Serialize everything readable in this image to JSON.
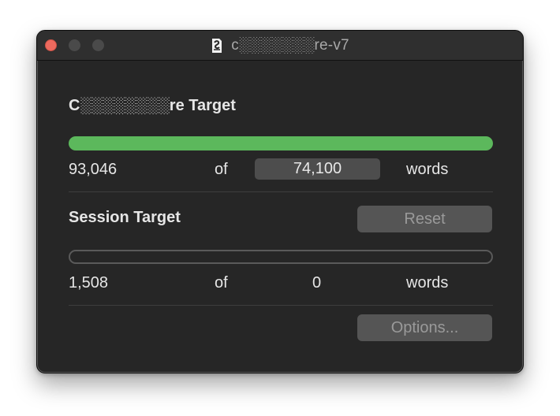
{
  "window": {
    "title": "c░░░░░░░re-v7",
    "icons": {
      "close": "close-button",
      "minimize": "minimize-button",
      "zoom": "zoom-button",
      "document": "scrivener-document-icon"
    },
    "colors": {
      "close": "#ed6a5e",
      "progress_fill": "#5cb85c",
      "background": "#262626"
    }
  },
  "draft_target": {
    "heading": "C░░░░░░░░re Target",
    "progress_fraction": 1.0,
    "current": "93,046",
    "of_label": "of",
    "target": "74,100",
    "unit": "words"
  },
  "session_target": {
    "heading": "Session Target",
    "reset_label": "Reset",
    "progress_fraction": 0.0,
    "current": "1,508",
    "of_label": "of",
    "target": "0",
    "unit": "words"
  },
  "footer": {
    "options_label": "Options..."
  }
}
